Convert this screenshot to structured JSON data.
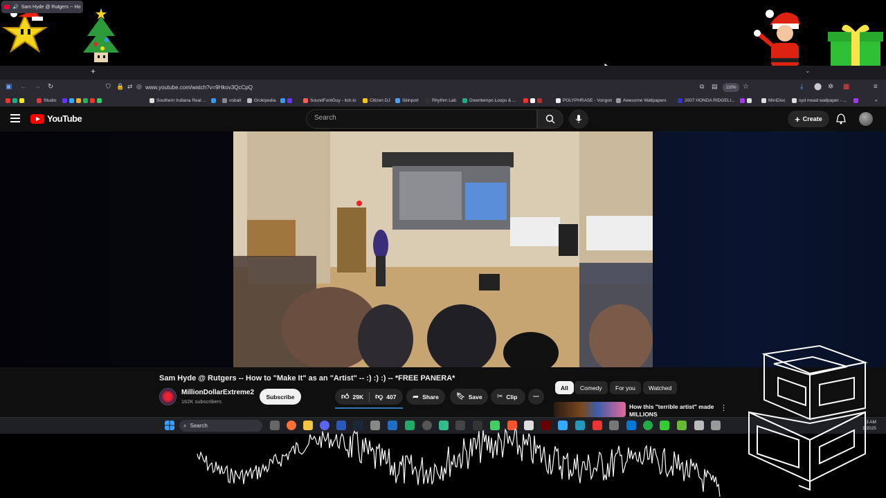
{
  "browser": {
    "tab_title": "Sam Hyde @ Rutgers -- Ho",
    "url": "www.youtube.com/watch?v=9Hkov3QcCpQ",
    "zoom": "110%",
    "bookmarks": [
      {
        "label": "Studio",
        "color": "#e33"
      },
      {
        "label": "Southern Indiana Real ...",
        "color": "#ddd"
      },
      {
        "label": "cobalt",
        "color": "#888"
      },
      {
        "label": "Grokipedia",
        "color": "#bbb"
      },
      {
        "label": "SoundFontGuy - itch.io",
        "color": "#fa5c5c"
      },
      {
        "label": "Citizen DJ",
        "color": "#f5c518"
      },
      {
        "label": "Skinport",
        "color": "#4aa3ff"
      },
      {
        "label": "Rhythm Lab",
        "color": "#333"
      },
      {
        "label": "Downtempo Loops & ...",
        "color": "#2a8"
      },
      {
        "label": "POLYPHRASE - Vongon",
        "color": "#eee"
      },
      {
        "label": "Awesome Wallpapers",
        "color": "#999"
      },
      {
        "label": "2007 HONDA RIDGELI...",
        "color": "#33c"
      },
      {
        "label": "MiniDisc",
        "color": "#ddd"
      },
      {
        "label": "syd mead wallpaper - ...",
        "color": "#ddd"
      }
    ]
  },
  "youtube": {
    "logo_text": "YouTube",
    "search_placeholder": "Search",
    "create_label": "Create",
    "video_title": "Sam Hyde @ Rutgers -- How to \"Make It\" as an \"Artist\" -- :) :) :) -- *FREE PANERA*",
    "channel_name": "MillionDollarExtreme2",
    "channel_subs": "162K subscribers",
    "subscribe_label": "Subscribe",
    "likes": "29K",
    "dislikes": "407",
    "share_label": "Share",
    "save_label": "Save",
    "clip_label": "Clip",
    "chips": [
      "All",
      "Comedy",
      "For you",
      "Watched"
    ],
    "rec_title": "How this \"terrible artist\" made MILLIONS"
  },
  "taskbar": {
    "search_placeholder": "Search",
    "time": "3 AM",
    "date": "1/2025"
  }
}
